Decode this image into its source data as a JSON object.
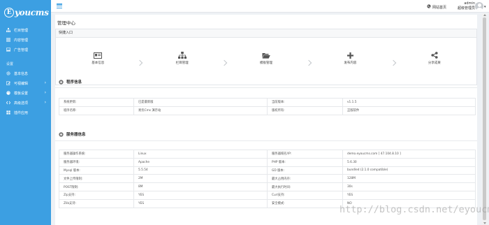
{
  "brand": {
    "logo_letter": "E",
    "logo_text": "youcms",
    "accent": "#3c9fe2"
  },
  "sidebar": {
    "items_top": [
      {
        "label": "栏目管理",
        "icon": "sitemap-icon"
      },
      {
        "label": "内容管理",
        "icon": "list-icon"
      },
      {
        "label": "广告管理",
        "icon": "image-icon"
      }
    ],
    "group_label": "设置",
    "items_bottom": [
      {
        "label": "基本信息",
        "icon": "gear-icon",
        "has_children": false
      },
      {
        "label": "可视编辑",
        "icon": "edit-icon",
        "has_children": true
      },
      {
        "label": "模板设置",
        "icon": "palette-icon",
        "has_children": true
      },
      {
        "label": "高级选项",
        "icon": "code-icon",
        "has_children": true
      },
      {
        "label": "插件应用",
        "icon": "plugin-icon",
        "has_children": false
      }
    ]
  },
  "topbar": {
    "home_label": "网站首页",
    "username": "admin",
    "role": "超级管理员"
  },
  "page": {
    "title": "管理中心"
  },
  "quick": {
    "title": "快捷入口",
    "items": [
      {
        "label": "基本信息",
        "icon": "id-card-icon"
      },
      {
        "label": "栏目管理",
        "icon": "sitemap-icon"
      },
      {
        "label": "模板管理",
        "icon": "folder-open-icon"
      },
      {
        "label": "发布内容",
        "icon": "plus-icon"
      },
      {
        "label": "分享成果",
        "icon": "share-icon"
      }
    ]
  },
  "program": {
    "title": "程序信息",
    "rows": [
      [
        "系统更新:",
        "已是最新版",
        "当前版本:",
        "v1.1.5"
      ],
      [
        "程序名称:",
        "易优Cms 演示站",
        "版权所有:",
        "正版软件"
      ]
    ]
  },
  "server": {
    "title": "服务器信息",
    "rows": [
      [
        "服务器操作系统:",
        "Linux",
        "服务器域名/IP:",
        "demo.eyoucms.com [ 47.104.8.10 ]"
      ],
      [
        "服务器环境:",
        "Apache",
        "PHP 版本:",
        "5.6.30"
      ],
      [
        "Mysql 版本:",
        "5.5.54",
        "GD 版本:",
        "bundled (2.1.0 compatible)"
      ],
      [
        "文件上传限制:",
        "2M",
        "最大占用内存:",
        "128M"
      ],
      [
        "POST限制:",
        "8M",
        "最大执行时间:",
        "30s"
      ],
      [
        "Zip支持:",
        "YES",
        "Curl支持:",
        "YES"
      ],
      [
        "Zlib支持:",
        "YES",
        "安全模式:",
        "NO"
      ]
    ]
  },
  "watermark": "http://blog.csdn.net/eyoucms"
}
